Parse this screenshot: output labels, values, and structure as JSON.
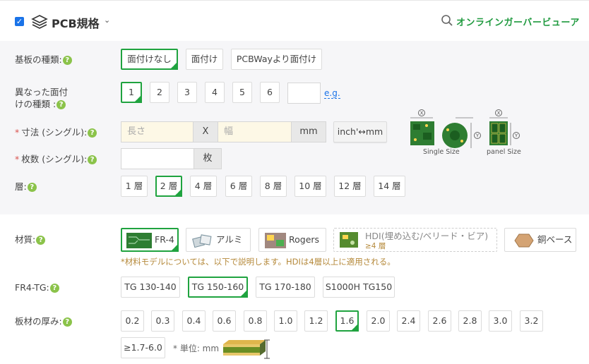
{
  "header": {
    "title": "PCB規格",
    "viewer_label": "オンラインガーバービューア"
  },
  "board_type": {
    "label": "基板の種類:",
    "options": [
      "面付けなし",
      "面付け",
      "PCBWayより面付け"
    ],
    "selected": "面付けなし"
  },
  "diff_designs": {
    "label_line1": "異なった面付",
    "label_line2": "けの種類 :",
    "options": [
      "1",
      "2",
      "3",
      "4",
      "5",
      "6"
    ],
    "selected": "1",
    "custom_value": "",
    "eg_link": "e.g."
  },
  "size": {
    "label": "寸法 (シングル):",
    "length_placeholder": "長さ",
    "x_sep": "X",
    "width_placeholder": "幅",
    "unit": "mm",
    "convert_button": "inch'↔mm",
    "diagram_single_label": "Single Size",
    "diagram_panel_label": "panel Size",
    "axis_x": "X",
    "axis_y": "Y"
  },
  "quantity": {
    "label": "枚数 (シングル):",
    "value": "",
    "unit": "枚"
  },
  "layers": {
    "label": "層:",
    "options": [
      "1 層",
      "2 層",
      "4 層",
      "6 層",
      "8 層",
      "10 層",
      "12 層",
      "14 層"
    ],
    "selected": "2 層"
  },
  "material": {
    "label": "材質:",
    "options": [
      "FR-4",
      "アルミ",
      "Rogers",
      "HDI(埋め込む/ベリード・ビア)",
      "銅ベース"
    ],
    "hdi_sub": "≥4 層",
    "selected": "FR-4",
    "note": "*材料モデルについては、以下で説明します。HDIは4層以上に適用される。"
  },
  "fr4_tg": {
    "label": "FR4-TG:",
    "options": [
      "TG 130-140",
      "TG 150-160",
      "TG 170-180",
      "S1000H TG150"
    ],
    "selected": "TG 150-160"
  },
  "thickness": {
    "label": "板材の厚み:",
    "options": [
      "0.2",
      "0.3",
      "0.4",
      "0.6",
      "0.8",
      "1.0",
      "1.2",
      "1.6",
      "2.0",
      "2.4",
      "2.6",
      "2.8",
      "3.0",
      "3.2"
    ],
    "extra_option": "≥1.7-6.0",
    "selected": "1.6",
    "unit_note": "* 単位: mm"
  },
  "colors": {
    "accent_green": "#1fa33f",
    "link_blue": "#1a73e8",
    "help_green": "#8bc34a"
  }
}
